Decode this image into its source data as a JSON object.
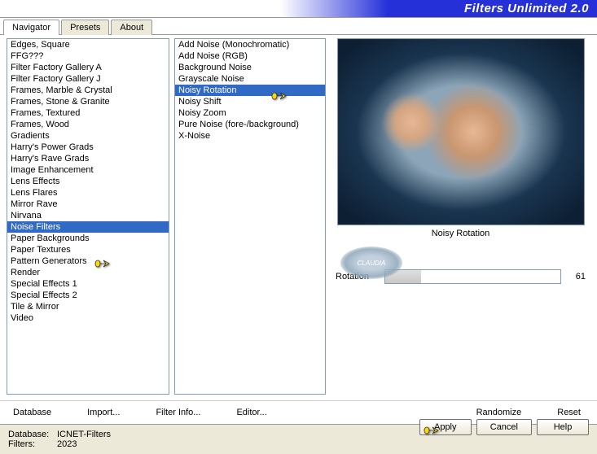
{
  "title": "Filters Unlimited 2.0",
  "tabs": {
    "navigator": "Navigator",
    "presets": "Presets",
    "about": "About"
  },
  "categories": [
    "Edges, Square",
    "FFG???",
    "Filter Factory Gallery A",
    "Filter Factory Gallery J",
    "Frames, Marble & Crystal",
    "Frames, Stone & Granite",
    "Frames, Textured",
    "Frames, Wood",
    "Gradients",
    "Harry's Power Grads",
    "Harry's Rave Grads",
    "Image Enhancement",
    "Lens Effects",
    "Lens Flares",
    "Mirror Rave",
    "Nirvana",
    "Noise Filters",
    "Paper Backgrounds",
    "Paper Textures",
    "Pattern Generators",
    "Render",
    "Special Effects 1",
    "Special Effects 2",
    "Tile & Mirror",
    "Video"
  ],
  "selected_category": "Noise Filters",
  "filters": [
    "Add Noise (Monochromatic)",
    "Add Noise (RGB)",
    "Background Noise",
    "Grayscale Noise",
    "Noisy Rotation",
    "Noisy Shift",
    "Noisy Zoom",
    "Pure Noise (fore-/background)",
    "X-Noise"
  ],
  "selected_filter": "Noisy Rotation",
  "preview_label": "Noisy Rotation",
  "slider": {
    "label": "Rotation",
    "value": "61"
  },
  "buttons": {
    "database": "Database",
    "import": "Import...",
    "filter_info": "Filter Info...",
    "editor": "Editor...",
    "randomize": "Randomize",
    "reset": "Reset",
    "apply": "Apply",
    "cancel": "Cancel",
    "help": "Help"
  },
  "status": {
    "db_label": "Database:",
    "db_value": "ICNET-Filters",
    "filters_label": "Filters:",
    "filters_value": "2023"
  },
  "watermark": "CLAUDIA"
}
